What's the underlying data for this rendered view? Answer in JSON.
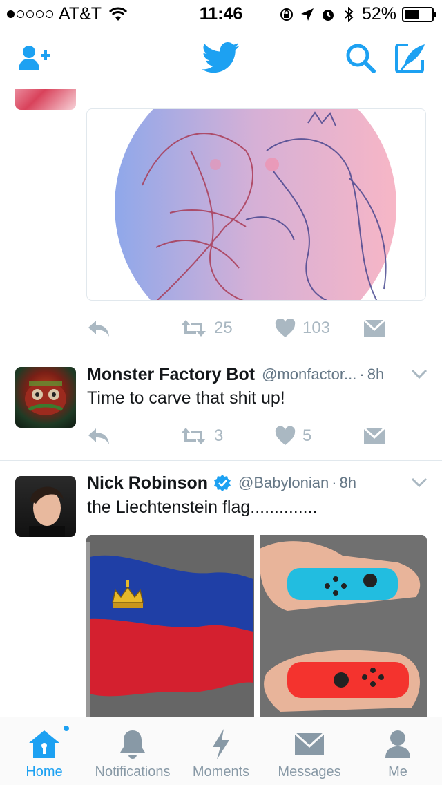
{
  "status_bar": {
    "carrier": "AT&T",
    "time": "11:46",
    "battery_percent_label": "52%",
    "battery_level": 0.52,
    "signal_bars_on": 1,
    "signal_bars_total": 5
  },
  "nav": {
    "icons": [
      "add-user-icon",
      "twitter-bird-icon",
      "search-icon",
      "compose-icon"
    ],
    "accent_color": "#1da1f2"
  },
  "tweets": [
    {
      "media": "illustration",
      "actions": {
        "retweets": "25",
        "likes": "103"
      }
    },
    {
      "display_name": "Monster Factory Bot",
      "handle": "@monfactor...",
      "time": "8h",
      "text": "Time to carve that shit up!",
      "actions": {
        "retweets": "3",
        "likes": "5"
      }
    },
    {
      "display_name": "Nick Robinson",
      "verified": true,
      "handle": "@Babylonian",
      "time": "8h",
      "text": "the Liechtenstein flag.............."
    }
  ],
  "tab_bar": {
    "home": "Home",
    "notifications": "Notifications",
    "moments": "Moments",
    "messages": "Messages",
    "me": "Me",
    "active_tab": "Home"
  },
  "colors": {
    "inactive": "#8899a6",
    "action_gray": "#aab8c2",
    "divider": "#e1e8ed"
  }
}
